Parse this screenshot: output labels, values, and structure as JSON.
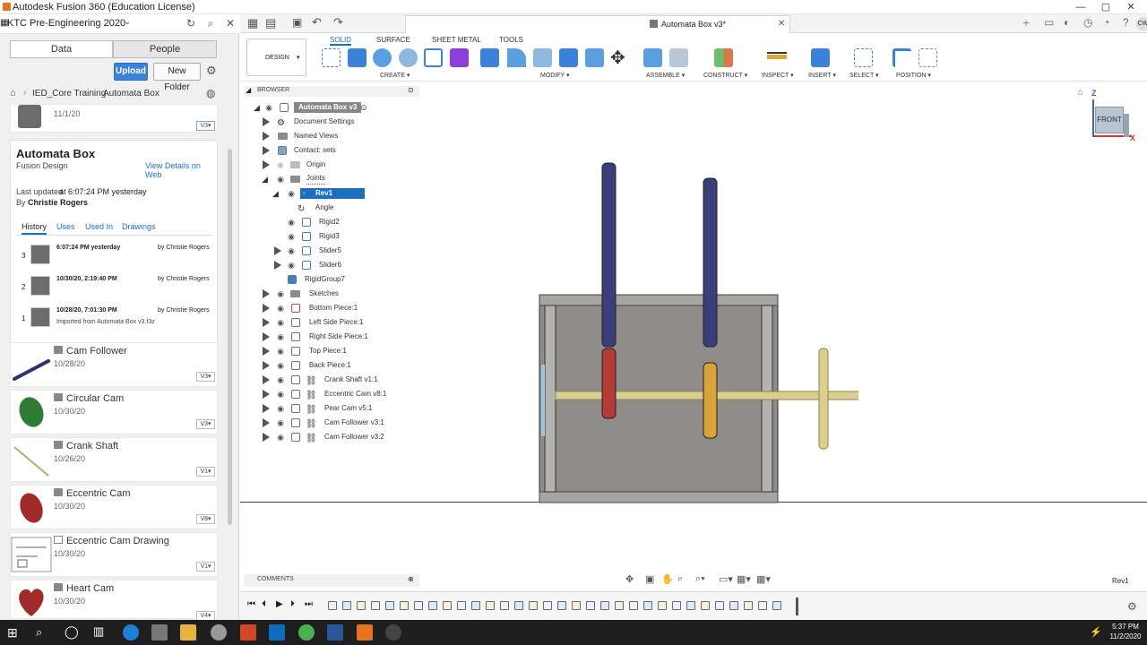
{
  "window": {
    "title": "Autodesk Fusion 360 (Education License)",
    "controls": [
      "—",
      "▢",
      "✕"
    ]
  },
  "hub": {
    "project": "KTC Pre-Engineering 2020",
    "tabs": [
      "Data",
      "People"
    ],
    "upload": "Upload",
    "new_folder": "New Folder"
  },
  "breadcrumb": {
    "folder": "IED_Core Training",
    "current": "Automata Box"
  },
  "top_item": {
    "date": "11/1/20",
    "version": "V3"
  },
  "details": {
    "name": "Automata Box",
    "type": "Fusion Design",
    "view_link": "View Details on Web",
    "updated_prefix": "Last updated",
    "updated_time": "at 6:07:24 PM yesterday",
    "by_prefix": "By",
    "by": "Christie Rogers",
    "tabs": [
      "History",
      "Uses",
      "Used In",
      "Drawings"
    ],
    "history": [
      {
        "num": "3",
        "time": "6:07:24 PM yesterday",
        "by": "by Christie Rogers",
        "note": ""
      },
      {
        "num": "2",
        "time": "10/30/20, 2:19:40 PM",
        "by": "by Christie Rogers",
        "note": ""
      },
      {
        "num": "1",
        "time": "10/28/20, 7:01:30 PM",
        "by": "by Christie Rogers",
        "note": "Imported from Automata Box v3.f3z"
      }
    ]
  },
  "files": [
    {
      "name": "Cam Follower",
      "date": "10/28/20",
      "version": "V3"
    },
    {
      "name": "Circular Cam",
      "date": "10/30/20",
      "version": "V3"
    },
    {
      "name": "Crank Shaft",
      "date": "10/26/20",
      "version": "V1"
    },
    {
      "name": "Eccentric Cam",
      "date": "10/30/20",
      "version": "V8"
    },
    {
      "name": "Eccentric Cam Drawing",
      "date": "10/30/20",
      "version": "V1"
    },
    {
      "name": "Heart Cam",
      "date": "10/30/20",
      "version": "V4"
    }
  ],
  "document": {
    "tab": "Automata Box v3*"
  },
  "ribbon": {
    "workspace": "DESIGN",
    "tabs": [
      "SOLID",
      "SURFACE",
      "SHEET METAL",
      "TOOLS"
    ],
    "groups": [
      "CREATE",
      "MODIFY",
      "ASSEMBLE",
      "CONSTRUCT",
      "INSPECT",
      "INSERT",
      "SELECT",
      "POSITION"
    ]
  },
  "browser": {
    "title": "BROWSER",
    "root": "Automata Box v3",
    "items": [
      "Document Settings",
      "Named Views",
      "Contact: sets",
      "Origin",
      "Joints",
      "Rev1",
      "Angle",
      "Rigid2",
      "Rigid3",
      "Slider5",
      "Slider6",
      "RigidGroup7",
      "Sketches",
      "Bottom Piece:1",
      "Left Side Piece:1",
      "Right Side Piece:1",
      "Top Piece:1",
      "Back Piece:1",
      "Crank Shaft v1:1",
      "Eccentric Cam v8:1",
      "Pear Cam v5:1",
      "Cam Follower v3:1",
      "Cam Follower v3:2"
    ]
  },
  "viewcube": {
    "face": "FRONT",
    "z": "Z",
    "x": "X"
  },
  "comments": "COMMENTS",
  "status_right": "Rev1",
  "user_initials": "CW",
  "clock": {
    "time": "5:37 PM",
    "date": "11/2/2020"
  },
  "colors": {
    "accent": "#1f6fc1",
    "follower": "#3a3f7a",
    "shaft": "#d9cf8e",
    "cam_red": "#b43a35",
    "cam_orange": "#d9a23a",
    "box": "#8f8d89"
  }
}
